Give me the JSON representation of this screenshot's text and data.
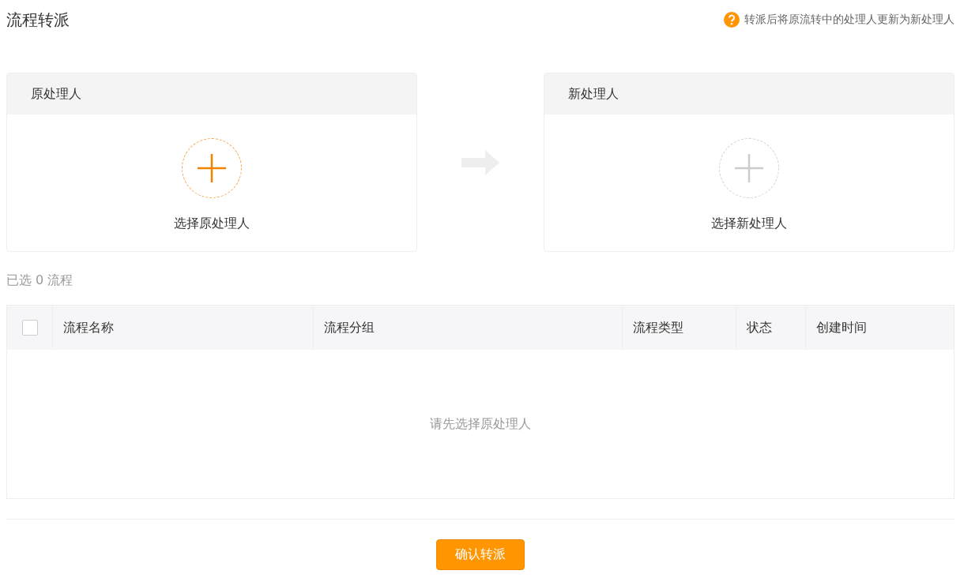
{
  "title": "流程转派",
  "hint": "转派后将原流转中的处理人更新为新处理人",
  "panels": [
    {
      "header": "原处理人",
      "action": "选择原处理人",
      "disabled": false
    },
    {
      "header": "新处理人",
      "action": "选择新处理人",
      "disabled": true
    }
  ],
  "selected_count": "已选 0 流程",
  "table": {
    "select_all_checked": false,
    "columns": [
      "流程名称",
      "流程分组",
      "流程类型",
      "状态",
      "创建时间"
    ],
    "empty_text": "请先选择原处理人"
  },
  "confirm_button": "确认转派"
}
